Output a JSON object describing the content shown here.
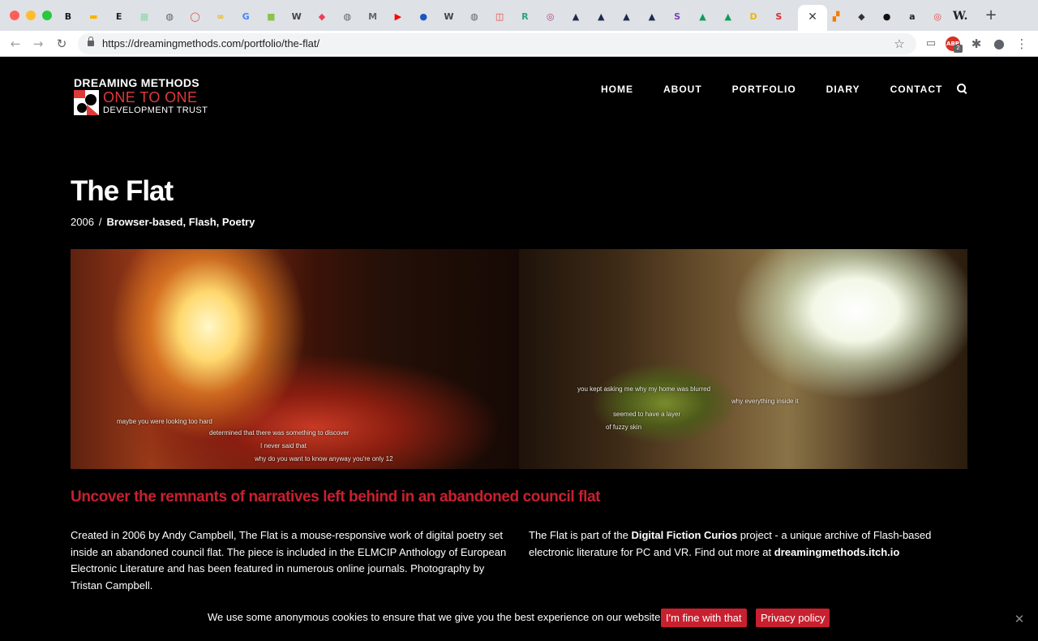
{
  "browser": {
    "tabs": [
      {
        "icon": "blogger-icon",
        "glyph": "B",
        "color": "#1a1a1a"
      },
      {
        "icon": "slides-icon",
        "glyph": "▬",
        "color": "#f4b400"
      },
      {
        "icon": "e-icon",
        "glyph": "E",
        "color": "#222222"
      },
      {
        "icon": "sheets-icon",
        "glyph": "▦",
        "color": "#8fd4a8"
      },
      {
        "icon": "globe-icon",
        "glyph": "◍",
        "color": "#5f6368"
      },
      {
        "icon": "drop-icon",
        "glyph": "◯",
        "color": "#e8453c"
      },
      {
        "icon": "infinity-icon",
        "glyph": "∞",
        "color": "#f4b400"
      },
      {
        "icon": "google-icon",
        "glyph": "G",
        "color": "#4285f4"
      },
      {
        "icon": "green-square-icon",
        "glyph": "■",
        "color": "#8bc34a"
      },
      {
        "icon": "wikipedia-icon",
        "glyph": "W",
        "color": "#444444"
      },
      {
        "icon": "pocket-icon",
        "glyph": "◆",
        "color": "#ef3f56"
      },
      {
        "icon": "globe-icon-2",
        "glyph": "◍",
        "color": "#5f6368"
      },
      {
        "icon": "medium-icon",
        "glyph": "M",
        "color": "#666666"
      },
      {
        "icon": "youtube-icon",
        "glyph": "▶",
        "color": "#ff0000"
      },
      {
        "icon": "blue-dot-icon",
        "glyph": "●",
        "color": "#1a56c4"
      },
      {
        "icon": "wikipedia-icon-2",
        "glyph": "W",
        "color": "#444444"
      },
      {
        "icon": "globe-icon-3",
        "glyph": "◍",
        "color": "#5f6368"
      },
      {
        "icon": "reader-icon",
        "glyph": "◫",
        "color": "#e8453c"
      },
      {
        "icon": "r-icon",
        "glyph": "R",
        "color": "#2aa37a"
      },
      {
        "icon": "instagram-icon",
        "glyph": "◎",
        "color": "#c13584"
      },
      {
        "icon": "ark-icon-1",
        "glyph": "▲",
        "color": "#1f2b4d"
      },
      {
        "icon": "ark-icon-2",
        "glyph": "▲",
        "color": "#1f2b4d"
      },
      {
        "icon": "ark-icon-3",
        "glyph": "▲",
        "color": "#1f2b4d"
      },
      {
        "icon": "ark-icon-4",
        "glyph": "▲",
        "color": "#1f2b4d"
      },
      {
        "icon": "s-circle-icon",
        "glyph": "S",
        "color": "#7b3fb8"
      },
      {
        "icon": "drive-icon",
        "glyph": "▲",
        "color": "#0f9d58"
      },
      {
        "icon": "drive-icon-2",
        "glyph": "▲",
        "color": "#0f9d58"
      },
      {
        "icon": "d-icon",
        "glyph": "D",
        "color": "#f4b400"
      },
      {
        "icon": "scribd-icon",
        "glyph": "S",
        "color": "#d32f2f"
      }
    ],
    "active_tab_close": "✕",
    "more_tabs": [
      {
        "icon": "blocks-icon",
        "glyph": "▞",
        "color": "#f57c00"
      },
      {
        "icon": "diamond-icon",
        "glyph": "◆",
        "color": "#333333"
      },
      {
        "icon": "dark-circle-icon",
        "glyph": "●",
        "color": "#111111"
      },
      {
        "icon": "amazon-icon",
        "glyph": "a",
        "color": "#222222"
      },
      {
        "icon": "target-icon",
        "glyph": "◎",
        "color": "#e8453c"
      }
    ],
    "w_tab_label": "W.",
    "new_tab": "+",
    "back": "←",
    "forward": "→",
    "reload": "↻",
    "url": "https://dreamingmethods.com/portfolio/the-flat/",
    "star": "☆",
    "ext_drive": "▭",
    "ext_abp": "ABP",
    "ext_abp_badge": "2",
    "ext_puzzle": "✱",
    "ext_profile": "●",
    "ext_menu": "⋮"
  },
  "site": {
    "logo": {
      "line1": "DREAMING METHODS",
      "line2": "ONE TO ONE",
      "line3": "DEVELOPMENT TRUST"
    },
    "nav": [
      "HOME",
      "ABOUT",
      "PORTFOLIO",
      "DIARY",
      "CONTACT"
    ],
    "title": "The Flat",
    "meta": {
      "year": "2006",
      "separator": "/",
      "categories": "Browser-based, Flash, Poetry"
    },
    "hero_text": {
      "left": [
        "maybe you were looking too hard",
        "determined that there was something to discover",
        "I never said that",
        "why do you want to know anyway you're only 12"
      ],
      "right": [
        "you kept asking me why my home was blurred",
        "why everything inside it",
        "seemed to have a layer",
        "of fuzzy skin"
      ]
    },
    "tagline": "Uncover the remnants of narratives left behind in an abandoned council flat",
    "col_left": "Created in 2006 by Andy Campbell, The Flat is a mouse-responsive work of digital poetry set inside an abandoned council flat. The piece is included in the ELMCIP Anthology of European Electronic Literature and has been featured in numerous online journals. Photography by Tristan Campbell.",
    "col_right": {
      "pre": "The Flat is part of the ",
      "link1": "Digital Fiction Curios",
      "mid": " project - a unique archive of Flash-based electronic literature for PC and VR. Find out more at ",
      "link2": "dreamingmethods.itch.io"
    },
    "cookie": {
      "text": "We use some anonymous cookies to ensure that we give you the best experience on our website.",
      "accept": "I'm fine with that",
      "privacy": "Privacy policy",
      "close": "✕"
    },
    "colors": {
      "accent_red": "#c8202f",
      "logo_red": "#e0393a",
      "background": "#000000"
    }
  }
}
